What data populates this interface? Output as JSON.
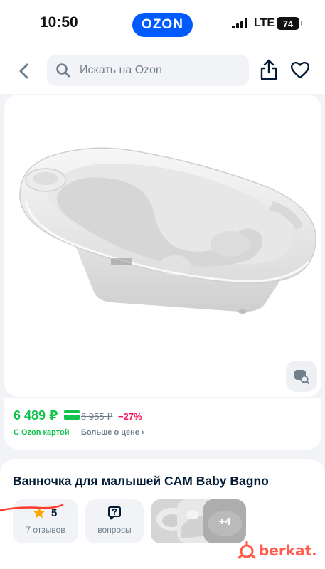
{
  "status_bar": {
    "time": "10:50",
    "network": "LTE",
    "battery": "74"
  },
  "app": {
    "logo": "OZON",
    "brand_color": "#005bff"
  },
  "header": {
    "search_placeholder": "Искать на Ozon",
    "icons": [
      "chevron-left-icon",
      "search-icon",
      "share-icon",
      "heart-icon"
    ]
  },
  "product": {
    "price": "6 489 ₽",
    "old_price": "8 955 ₽",
    "discount": "−27%",
    "ozon_card_note": "С Ozon картой",
    "more_price_link": "Больше о цене",
    "title": "Ванночка для малышей CAM Baby Bagno",
    "rating": "5",
    "reviews": "7 отзывов",
    "questions": "вопросы",
    "more_photos": "+4"
  },
  "colors": {
    "price_green": "#10c44c",
    "discount_red": "#f91155",
    "text_muted": "#707f8d"
  },
  "watermark": {
    "text": "berkat."
  }
}
